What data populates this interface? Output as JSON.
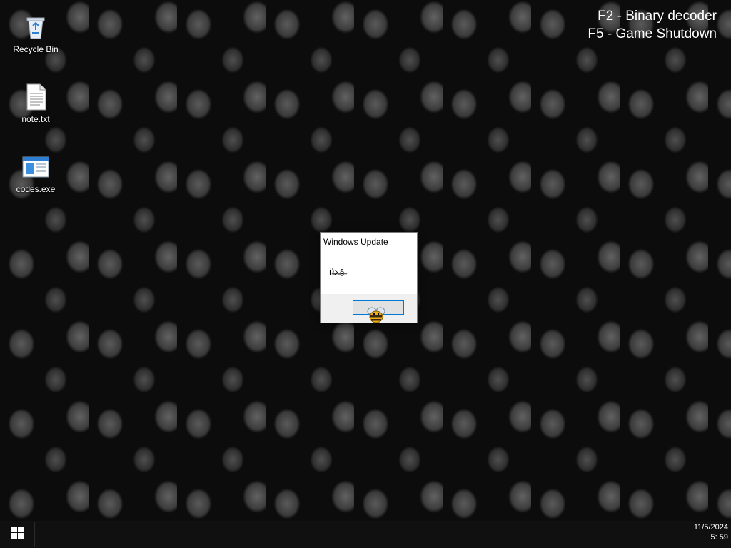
{
  "hint": {
    "line1": "F2 - Binary decoder",
    "line2": "F5 - Game Shutdown"
  },
  "desktop_icons": [
    {
      "label": "Recycle Bin",
      "icon": "recycle-bin-icon"
    },
    {
      "label": "note.txt",
      "icon": "text-file-icon"
    },
    {
      "label": "codes.exe",
      "icon": "executable-icon"
    }
  ],
  "dialog": {
    "title": "Windows Update",
    "message": "P̵̶̶̈Σ̵̶§̶",
    "ok_label": ""
  },
  "taskbar": {
    "start_icon": "windows-logo-icon",
    "date": "11/5/2024",
    "time": "5: 59"
  },
  "colors": {
    "desktop_bg": "#0c0c0c",
    "taskbar_bg": "#101010",
    "accent": "#0078d7"
  }
}
